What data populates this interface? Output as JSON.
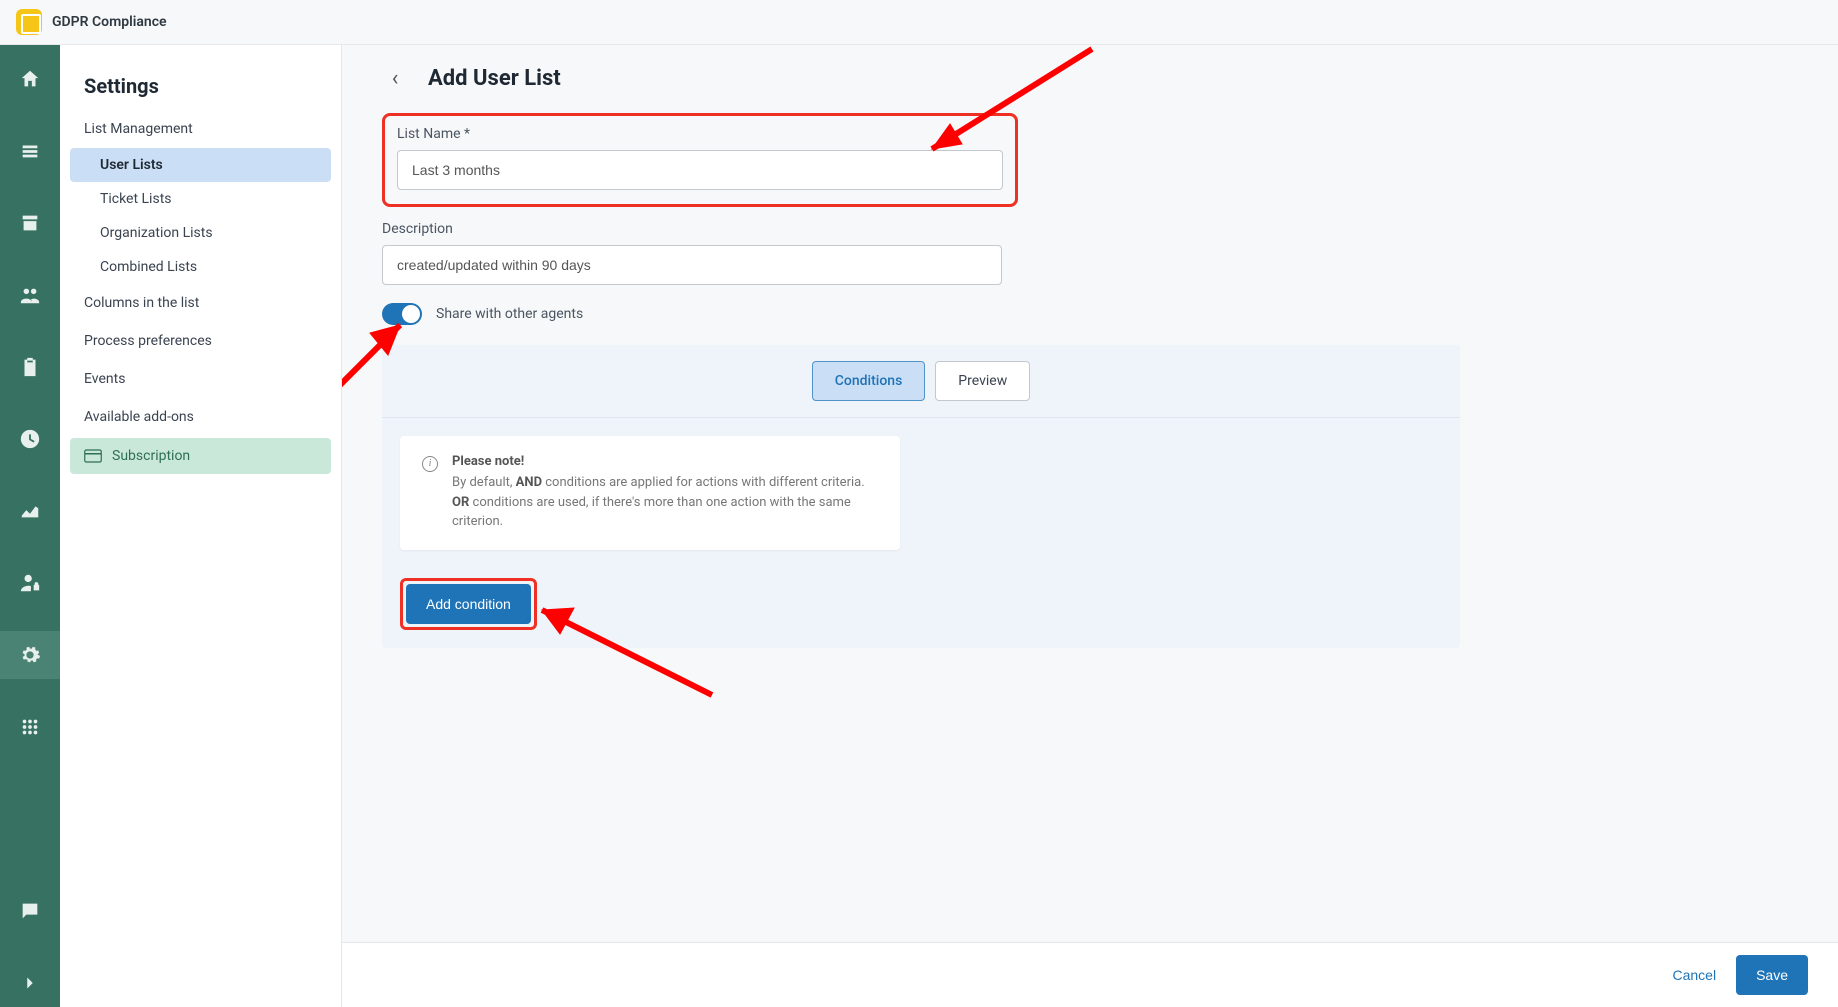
{
  "app_title": "GDPR Compliance",
  "sidebar": {
    "heading": "Settings",
    "list_mgmt_label": "List Management",
    "sub_user_lists": "User Lists",
    "sub_ticket_lists": "Ticket Lists",
    "sub_org_lists": "Organization Lists",
    "sub_combined_lists": "Combined Lists",
    "columns_label": "Columns in the list",
    "process_label": "Process preferences",
    "events_label": "Events",
    "addons_label": "Available add-ons",
    "subscription_label": "Subscription"
  },
  "page": {
    "title": "Add User List",
    "list_name_label": "List Name *",
    "list_name_value": "Last 3 months",
    "description_label": "Description",
    "description_value": "created/updated within 90 days",
    "share_label": "Share with other agents",
    "tabs": {
      "conditions": "Conditions",
      "preview": "Preview"
    },
    "note_title": "Please note!",
    "note_line1_prefix": "By default, ",
    "note_line1_bold": "AND",
    "note_line1_suffix": " conditions are applied for actions with different criteria.",
    "note_line2_bold": "OR",
    "note_line2_suffix": " conditions are used, if there's more than one action with the same criterion.",
    "add_condition_label": "Add condition"
  },
  "footer": {
    "cancel": "Cancel",
    "save": "Save"
  }
}
